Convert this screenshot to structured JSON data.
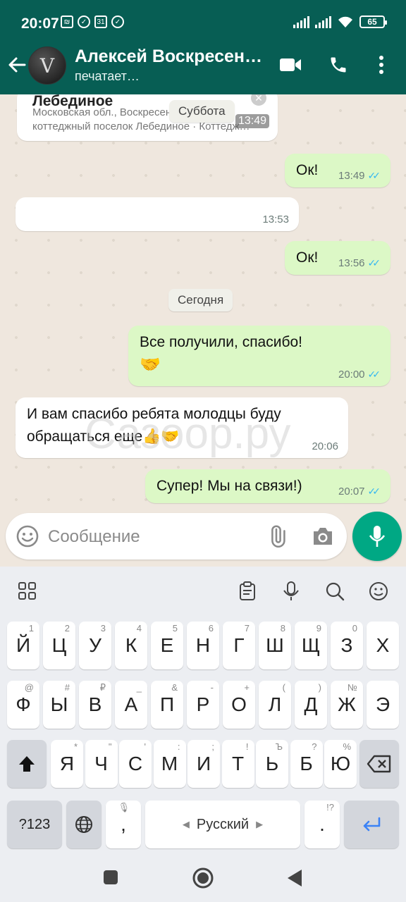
{
  "status_bar": {
    "time": "20:07",
    "battery": "65"
  },
  "header": {
    "contact_name": "Алексей Воскресен…",
    "contact_status": "печатает…"
  },
  "chat": {
    "location_card": {
      "title": "Лебединое",
      "address": "Московская обл., Воскресенский р-н, коттеджный поселок Лебединое · Коттедж…",
      "time": "13:49"
    },
    "date_chip_saturday": "Суббота",
    "date_chip_today": "Сегодня",
    "messages": [
      {
        "direction": "out",
        "text": "Ок!",
        "time": "13:49",
        "read": true
      },
      {
        "direction": "in",
        "text": "",
        "time": "13:53"
      },
      {
        "direction": "out",
        "text": "Ок!",
        "time": "13:56",
        "read": true
      },
      {
        "direction": "out",
        "text": "Все получили, спасибо!",
        "emoji": "🤝",
        "time": "20:00",
        "read": true
      },
      {
        "direction": "in",
        "text_line1": "И вам спасибо ребята молодцы буду",
        "text_line2": "обращаться еще👍🤝",
        "time": "20:06"
      },
      {
        "direction": "out",
        "text": "Супер! Мы на связи!)",
        "time": "20:07",
        "read": true
      }
    ],
    "watermark": "Сазоор.ру"
  },
  "composer": {
    "placeholder": "Сообщение"
  },
  "keyboard": {
    "row1": [
      {
        "label": "Й",
        "hint": "1"
      },
      {
        "label": "Ц",
        "hint": "2"
      },
      {
        "label": "У",
        "hint": "3"
      },
      {
        "label": "К",
        "hint": "4"
      },
      {
        "label": "Е",
        "hint": "5"
      },
      {
        "label": "Н",
        "hint": "6"
      },
      {
        "label": "Г",
        "hint": "7"
      },
      {
        "label": "Ш",
        "hint": "8"
      },
      {
        "label": "Щ",
        "hint": "9"
      },
      {
        "label": "З",
        "hint": "0"
      },
      {
        "label": "Х",
        "hint": ""
      }
    ],
    "row2": [
      {
        "label": "Ф",
        "hint": "@"
      },
      {
        "label": "Ы",
        "hint": "#"
      },
      {
        "label": "В",
        "hint": "₽"
      },
      {
        "label": "А",
        "hint": "_"
      },
      {
        "label": "П",
        "hint": "&"
      },
      {
        "label": "Р",
        "hint": "-"
      },
      {
        "label": "О",
        "hint": "+"
      },
      {
        "label": "Л",
        "hint": "("
      },
      {
        "label": "Д",
        "hint": ")"
      },
      {
        "label": "Ж",
        "hint": "№"
      },
      {
        "label": "Э",
        "hint": ""
      }
    ],
    "row3": [
      {
        "label": "Я",
        "hint": "*"
      },
      {
        "label": "Ч",
        "hint": "\""
      },
      {
        "label": "С",
        "hint": "'"
      },
      {
        "label": "М",
        "hint": ":"
      },
      {
        "label": "И",
        "hint": ";"
      },
      {
        "label": "Т",
        "hint": "!"
      },
      {
        "label": "Ь",
        "hint": "Ъ"
      },
      {
        "label": "Б",
        "hint": "?"
      },
      {
        "label": "Ю",
        "hint": "%"
      }
    ],
    "symbols_key": "?123",
    "comma_key": ",",
    "space_label": "Русский",
    "period_key": ".",
    "period_hint": "!?"
  }
}
